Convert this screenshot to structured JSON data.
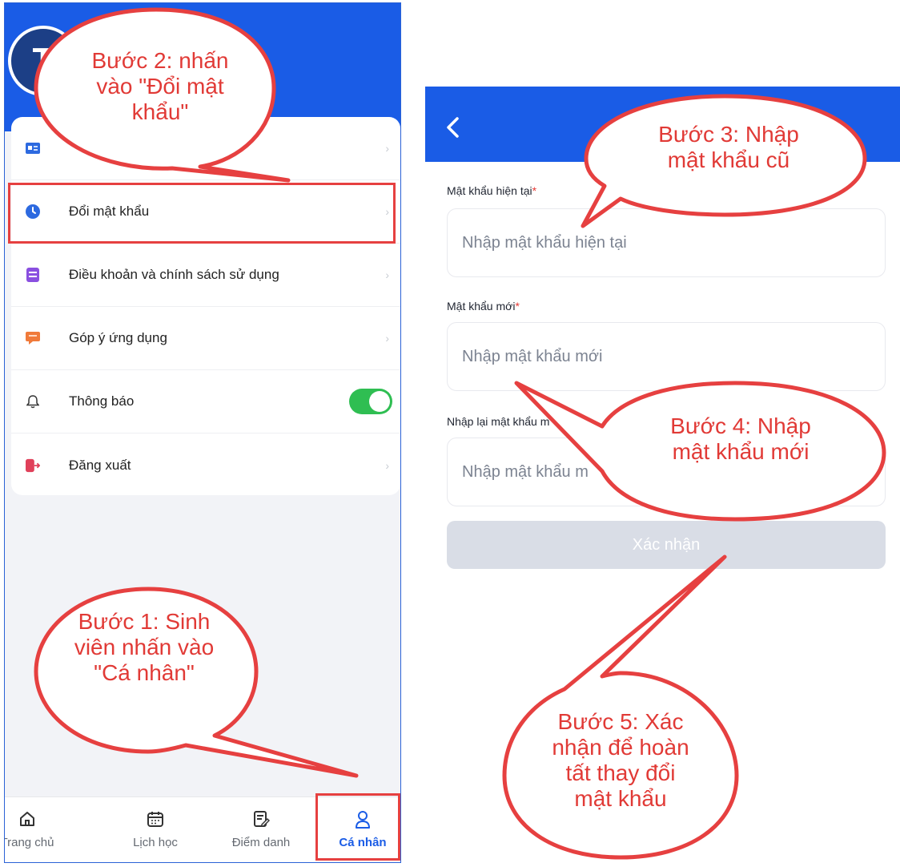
{
  "left": {
    "avatar_letter": "T",
    "menu": [
      {
        "label": "",
        "icon": "id-card-icon"
      },
      {
        "label": "Đổi mật khẩu",
        "icon": "clock-icon"
      },
      {
        "label": "Điều khoản và chính sách sử dụng",
        "icon": "document-icon"
      },
      {
        "label": "Góp ý ứng dụng",
        "icon": "feedback-icon"
      },
      {
        "label": "Thông báo",
        "icon": "bell-icon",
        "toggle_on": true
      },
      {
        "label": "Đăng xuất",
        "icon": "logout-icon"
      }
    ],
    "nav": [
      {
        "label": "Trang chủ",
        "icon": "home-icon"
      },
      {
        "label": "Lịch học",
        "icon": "calendar-icon"
      },
      {
        "label": "Điểm danh",
        "icon": "checklist-icon"
      },
      {
        "label": "Cá nhân",
        "icon": "person-icon",
        "active": true
      }
    ]
  },
  "right": {
    "fields": [
      {
        "label": "Mật khẩu hiện tại",
        "required": "*",
        "placeholder": "Nhập mật khẩu hiện tại"
      },
      {
        "label": "Mật khẩu mới",
        "required": "*",
        "placeholder": "Nhập mật khẩu mới"
      },
      {
        "label": "Nhập lại mật khẩu m",
        "placeholder": "Nhập mật khẩu m"
      }
    ],
    "confirm_label": "Xác nhận"
  },
  "callouts": {
    "step1": [
      "Bước 1: Sinh",
      "viên nhấn vào",
      "\"Cá nhân\""
    ],
    "step2": [
      "Bước 2: nhấn",
      "vào \"Đổi mật",
      "khẩu\""
    ],
    "step3": [
      "Bước 3: Nhập",
      "mật khẩu cũ"
    ],
    "step4": [
      "Bước 4: Nhập",
      "mật khẩu mới"
    ],
    "step5": [
      "Bước 5: Xác",
      "nhận để hoàn",
      "tất thay đổi",
      "mật khẩu"
    ]
  },
  "colors": {
    "brand_blue": "#1a5ce6",
    "callout_border": "#e64040",
    "callout_text": "#e13a36",
    "toggle_green": "#2fbe52"
  }
}
